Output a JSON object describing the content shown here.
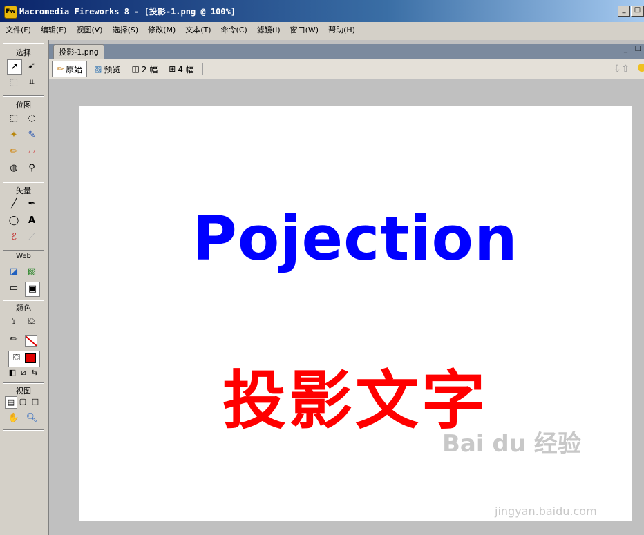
{
  "window": {
    "title": "Macromedia Fireworks 8 - [投影-1.png @ 100%]",
    "app_icon_label": "Fw"
  },
  "menu": [
    "文件(F)",
    "编辑(E)",
    "视图(V)",
    "选择(S)",
    "修改(M)",
    "文本(T)",
    "命令(C)",
    "滤镜(I)",
    "窗口(W)",
    "帮助(H)"
  ],
  "tools": {
    "sections": [
      "选择",
      "位图",
      "矢量",
      "Web",
      "颜色",
      "视图"
    ]
  },
  "document": {
    "tab_label": "投影-1.png",
    "views": {
      "original": "原始",
      "preview": "预览",
      "two_up": "2 幅",
      "four_up": "4 幅"
    }
  },
  "canvas": {
    "english_text": "Pojection",
    "chinese_text": "投影文字",
    "english_color": "#0000ff",
    "chinese_color": "#ff0000"
  },
  "watermark": {
    "text": "Bai du 经验",
    "sub": "jingyan.baidu.com"
  },
  "colors": {
    "stroke": "#ff0000",
    "fill": "#ff0000",
    "titlebar": "#0a246a"
  }
}
